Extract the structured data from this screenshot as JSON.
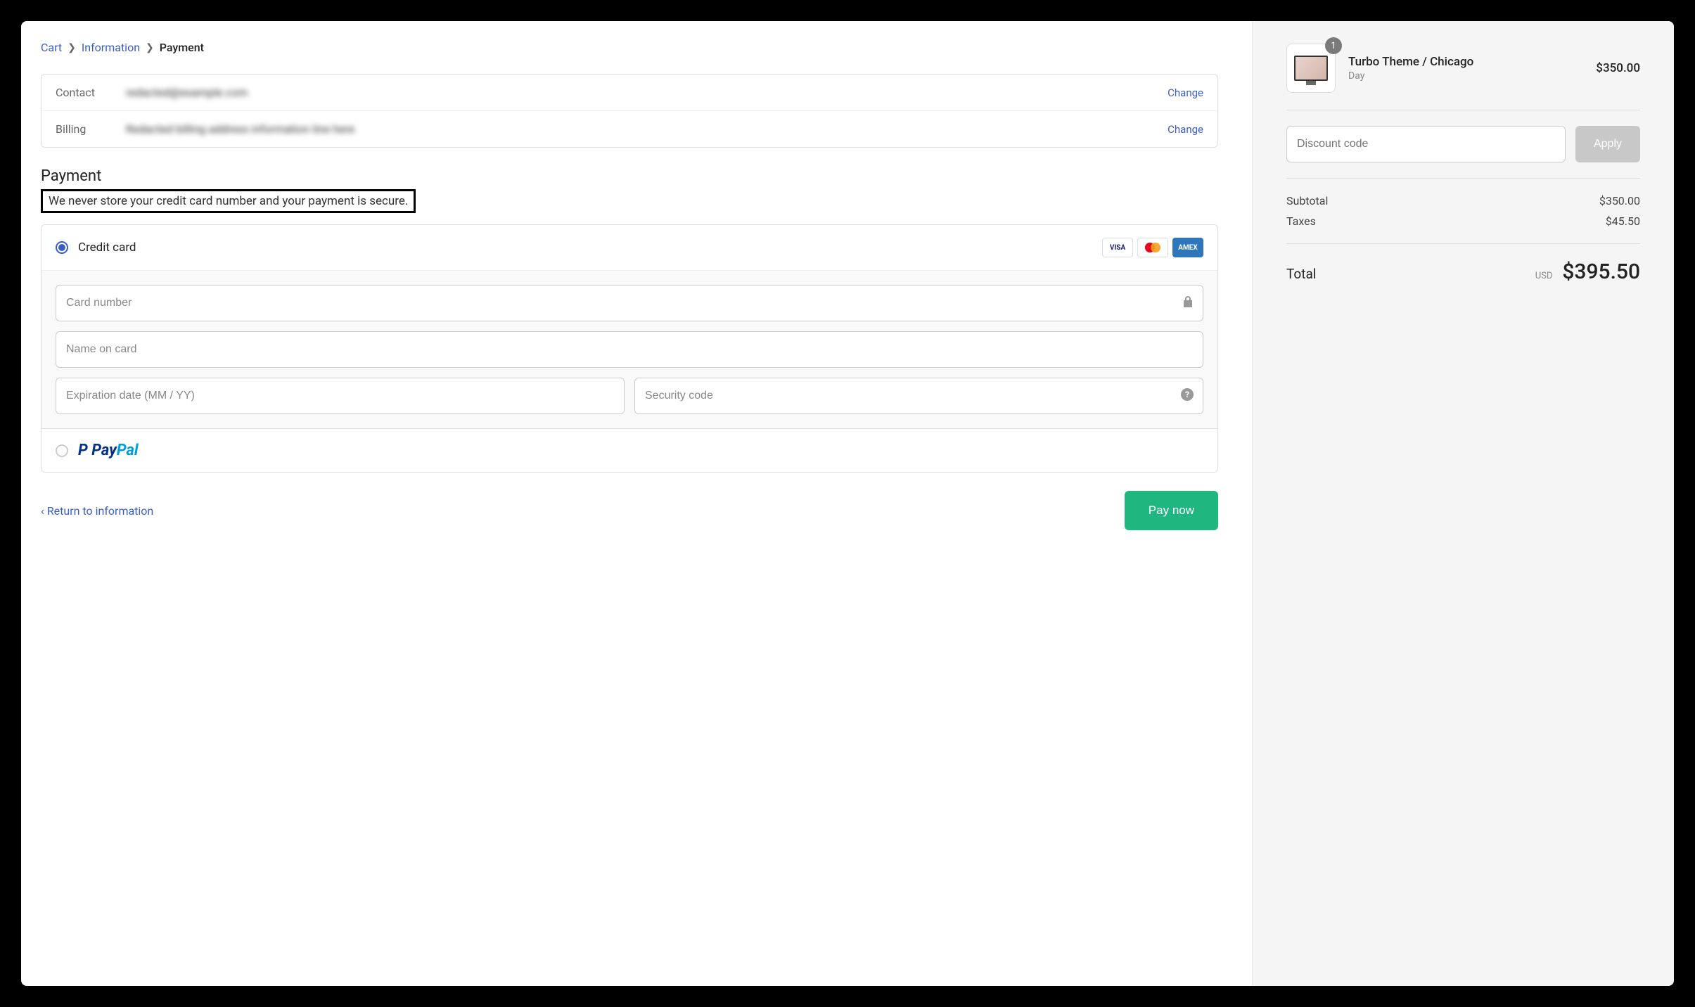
{
  "breadcrumbs": {
    "cart": "Cart",
    "information": "Information",
    "payment": "Payment"
  },
  "summary": {
    "contact_label": "Contact",
    "contact_value": "redacted@example.com",
    "billing_label": "Billing",
    "billing_value": "Redacted billing address information line here",
    "change": "Change"
  },
  "payment": {
    "title": "Payment",
    "security_note": "We never store your credit card number and your payment is secure.",
    "credit_card_label": "Credit card",
    "card_number_placeholder": "Card number",
    "name_placeholder": "Name on card",
    "expiry_placeholder": "Expiration date (MM / YY)",
    "cvv_placeholder": "Security code",
    "brands": {
      "visa": "VISA",
      "amex": "AMEX"
    }
  },
  "actions": {
    "return": "Return to information",
    "pay": "Pay now"
  },
  "cart": {
    "item": {
      "name": "Turbo Theme / Chicago",
      "variant": "Day",
      "price": "$350.00",
      "qty": "1"
    },
    "discount_placeholder": "Discount code",
    "apply": "Apply",
    "subtotal_label": "Subtotal",
    "subtotal_value": "$350.00",
    "taxes_label": "Taxes",
    "taxes_value": "$45.50",
    "total_label": "Total",
    "total_currency": "USD",
    "total_value": "$395.50"
  }
}
